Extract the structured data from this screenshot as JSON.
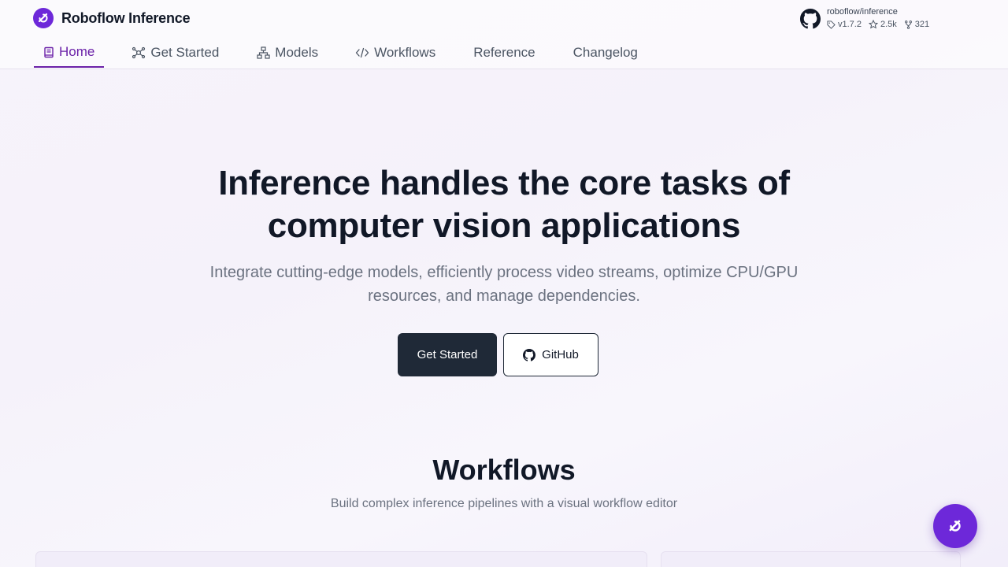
{
  "header": {
    "title": "Roboflow Inference",
    "repo": {
      "name": "roboflow/inference",
      "version": "v1.7.2",
      "stars": "2.5k",
      "forks": "321"
    }
  },
  "nav": {
    "items": [
      {
        "label": "Home",
        "icon": "book-icon",
        "active": true
      },
      {
        "label": "Get Started",
        "icon": "network-icon"
      },
      {
        "label": "Models",
        "icon": "sitemap-icon"
      },
      {
        "label": "Workflows",
        "icon": "code-icon"
      },
      {
        "label": "Reference"
      },
      {
        "label": "Changelog"
      }
    ]
  },
  "hero": {
    "title_line1": "Inference handles the core tasks of",
    "title_line2": "computer vision applications",
    "subtitle_line1": "Integrate cutting-edge models, efficiently process video streams, optimize CPU/GPU",
    "subtitle_line2": "resources, and manage dependencies.",
    "primary_button": "Get Started",
    "secondary_button": "GitHub"
  },
  "workflows": {
    "title": "Workflows",
    "subtitle": "Build complex inference pipelines with a visual workflow editor"
  },
  "colors": {
    "brand": "#6d28d9",
    "active_nav": "#6b21a8",
    "primary_button": "#1f2937"
  }
}
